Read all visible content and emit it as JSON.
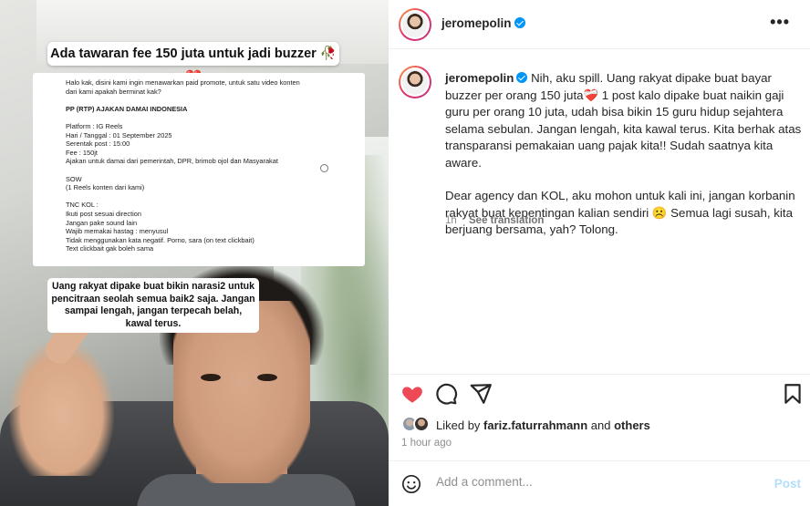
{
  "media": {
    "headline": "Ada tawaran fee 150 juta untuk jadi buzzer 🥀💔",
    "doc_lines": [
      "Halo kak, disini kami ingin menawarkan paid promote, untuk satu video konten",
      "dari kami apakah berminat kak?",
      "",
      "PP (RTP) AJAKAN DAMAI INDONESIA",
      "",
      "Platform : IG Reels",
      "Hari / Tanggal : 01 September 2025",
      "Serentak post : 15:00",
      "Fee : 150jt",
      "Ajakan untuk damai dari pemerintah, DPR, brimob ojol dan Masyarakat",
      "",
      "SOW",
      "(1 Reels konten dari kami)",
      "",
      "TNC KOL :",
      "Ikuti post sesuai direction",
      "Jangan pake sound lain",
      "Wajib memakai hastag : menyusul",
      "Tidak menggunakan kata negatif. Porno, sara (on text clickbait)",
      "Text clickbait gak boleh sama"
    ],
    "caption": "Uang rakyat dipake buat bikin narasi2 untuk pencitraan seolah semua baik2 saja. Jangan sampai lengah, jangan terpecah belah, kawal terus."
  },
  "header": {
    "username": "jeromepolin",
    "more_icon": "more-horizontal-icon",
    "more_label": "•••"
  },
  "post": {
    "username": "jeromepolin",
    "paragraph1": "Nih, aku spill. Uang rakyat dipake buat bayar buzzer per orang 150 juta❤️‍🩹 1 post kalo dipake buat naikin gaji guru per orang 10 juta, udah bisa bikin 15 guru hidup sejahtera selama sebulan. Jangan lengah, kita kawal terus. Kita berhak atas transparansi pemakaian uang pajak kita!! Sudah saatnya kita aware.",
    "paragraph2": "Dear agency dan KOL, aku mohon untuk kali ini, jangan korbanin rakyat buat kepentingan kalian sendiri ☹️ Semua lagi susah, kita berjuang bersama, yah? Tolong.",
    "time": "1h",
    "see_translation": "See translation"
  },
  "actions": {
    "like_icon": "heart-filled-icon",
    "comment_icon": "comment-icon",
    "share_icon": "share-icon",
    "save_icon": "bookmark-icon",
    "like_color": "#ed4956"
  },
  "likes": {
    "prefix": "Liked by ",
    "user": "fariz.faturrahmann",
    "middle": " and ",
    "others": "others"
  },
  "timestamp": "1 hour ago",
  "add_comment": {
    "emoji_icon": "emoji-icon",
    "placeholder": "Add a comment...",
    "post_label": "Post"
  }
}
